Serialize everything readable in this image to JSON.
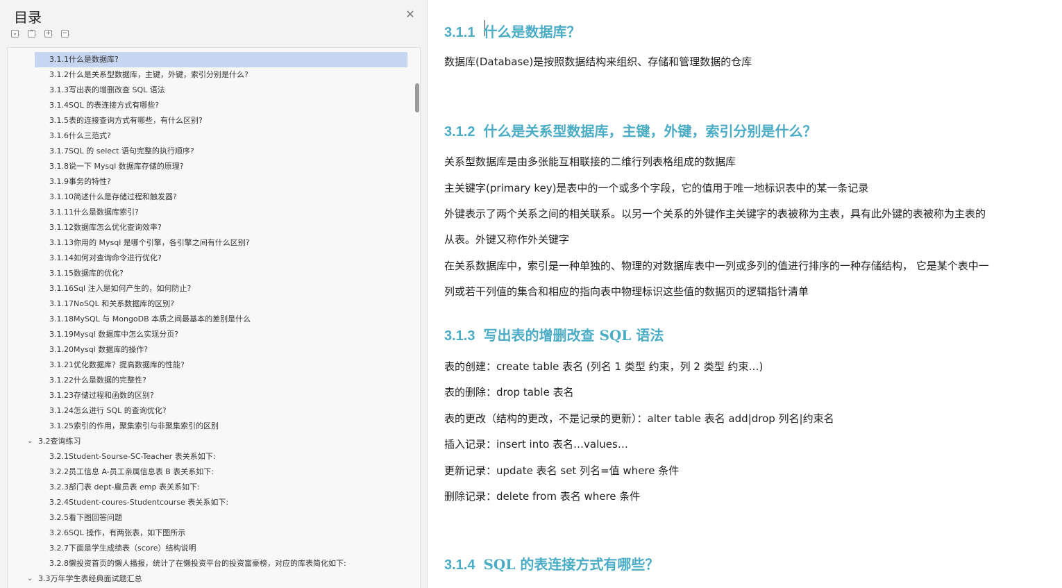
{
  "toc": {
    "title": "目录",
    "toolbar": {
      "expand": "⌄",
      "collapse": "⌃",
      "add": "+",
      "remove": "−"
    },
    "items": [
      {
        "label": "3.1.1什么是数据库?",
        "level": 3,
        "selected": true
      },
      {
        "label": "3.1.2什么是关系型数据库，主键，外键，索引分别是什么?",
        "level": 3
      },
      {
        "label": "3.1.3写出表的增删改查 SQL 语法",
        "level": 3
      },
      {
        "label": "3.1.4SQL 的表连接方式有哪些?",
        "level": 3
      },
      {
        "label": "3.1.5表的连接查询方式有哪些，有什么区别?",
        "level": 3
      },
      {
        "label": "3.1.6什么三范式?",
        "level": 3
      },
      {
        "label": "3.1.7SQL  的  select  语句完整的执行顺序?",
        "level": 3
      },
      {
        "label": "3.1.8说一下  Mysql  数据库存储的原理?",
        "level": 3
      },
      {
        "label": "3.1.9事务的特性?",
        "level": 3
      },
      {
        "label": "3.1.10简述什么是存储过程和触发器?",
        "level": 3
      },
      {
        "label": "3.1.11什么是数据库索引?",
        "level": 3
      },
      {
        "label": "3.1.12数据库怎么优化查询效率?",
        "level": 3
      },
      {
        "label": "3.1.13你用的  Mysql  是哪个引擎，各引擎之间有什么区别?",
        "level": 3
      },
      {
        "label": "3.1.14如何对查询命令进行优化?",
        "level": 3
      },
      {
        "label": "3.1.15数据库的优化?",
        "level": 3
      },
      {
        "label": "3.1.16Sql  注入是如何产生的，如何防止?",
        "level": 3
      },
      {
        "label": "3.1.17NoSQL  和关系数据库的区别?",
        "level": 3
      },
      {
        "label": "3.1.18MySQL  与  MongoDB  本质之间最基本的差别是什么",
        "level": 3
      },
      {
        "label": "3.1.19Mysql  数据库中怎么实现分页?",
        "level": 3
      },
      {
        "label": "3.1.20Mysql  数据库的操作?",
        "level": 3
      },
      {
        "label": "3.1.21优化数据库？提高数据库的性能?",
        "level": 3
      },
      {
        "label": "3.1.22什么是数据的完整性?",
        "level": 3
      },
      {
        "label": "3.1.23存储过程和函数的区别?",
        "level": 3
      },
      {
        "label": "3.1.24怎么进行 SQL 的查询优化?",
        "level": 3
      },
      {
        "label": "3.1.25索引的作用，聚集索引与非聚集索引的区别",
        "level": 3
      },
      {
        "label": "3.2查询练习",
        "level": 2
      },
      {
        "label": "3.2.1Student-Sourse-SC-Teacher  表关系如下:",
        "level": 3
      },
      {
        "label": "3.2.2员工信息 A-员工亲属信息表 B  表关系如下:",
        "level": 3
      },
      {
        "label": "3.2.3部门表 dept-雇员表 emp  表关系如下:",
        "level": 3
      },
      {
        "label": "3.2.4Student-coures-Studentcourse  表关系如下:",
        "level": 3
      },
      {
        "label": "3.2.5看下图回答问题",
        "level": 3
      },
      {
        "label": "3.2.6SQL  操作，有两张表，如下图所示",
        "level": 3
      },
      {
        "label": "3.2.7下面是学生成绩表（score）结构说明",
        "level": 3
      },
      {
        "label": "3.2.8懒投资首页的懒人播报，统计了在懒投资平台的投资富豪榜，对应的库表简化如下:",
        "level": 3
      },
      {
        "label": "3.3万年学生表经典面试题汇总",
        "level": 2
      }
    ]
  },
  "document": {
    "headings": [
      {
        "num": "3.1.1",
        "text": "什么是数据库？"
      },
      {
        "num": "3.1.2",
        "text": "什么是关系型数据库，主键，外键，索引分别是什么？"
      },
      {
        "num": "3.1.3",
        "text": "写出表的增删改查 SQL 语法"
      },
      {
        "num": "3.1.4",
        "text": "SQL 的表连接方式有哪些？"
      }
    ],
    "paragraphs": {
      "p1": "数据库(Database)是按照数据结构来组织、存储和管理数据的仓库",
      "p2": "关系型数据库是由多张能互相联接的二维行列表格组成的数据库",
      "p3": "主关键字(primary key)是表中的一个或多个字段，它的值用于唯一地标识表中的某一条记录",
      "p4a": "外键表示了两个关系之间的相关联系。以另一个关系的外键作主关键字的表被称为主表，具有此外键的表被称为主表的",
      "p4b": "从表。外键又称作外关键字",
      "p5a": "在关系数据库中，索引是一种单独的、物理的对数据库表中一列或多列的值进行排序的一种存储结构，  它是某个表中一",
      "p5b": "列或若干列值的集合和相应的指向表中物理标识这些值的数据页的逻辑指针清单",
      "s1": "表的创建：create table  表名  (列名 1  类型  约束，列 2  类型  约束…)",
      "s2": "表的删除：drop table  表名",
      "s3": "表的更改（结构的更改，不是记录的更新）：alter table  表名  add|drop  列名|约束名",
      "s4": "插入记录：insert into  表名…values…",
      "s5": "更新记录：update  表名  set  列名=值  where  条件",
      "s6": "删除记录：delete from  表名  where  条件"
    }
  }
}
